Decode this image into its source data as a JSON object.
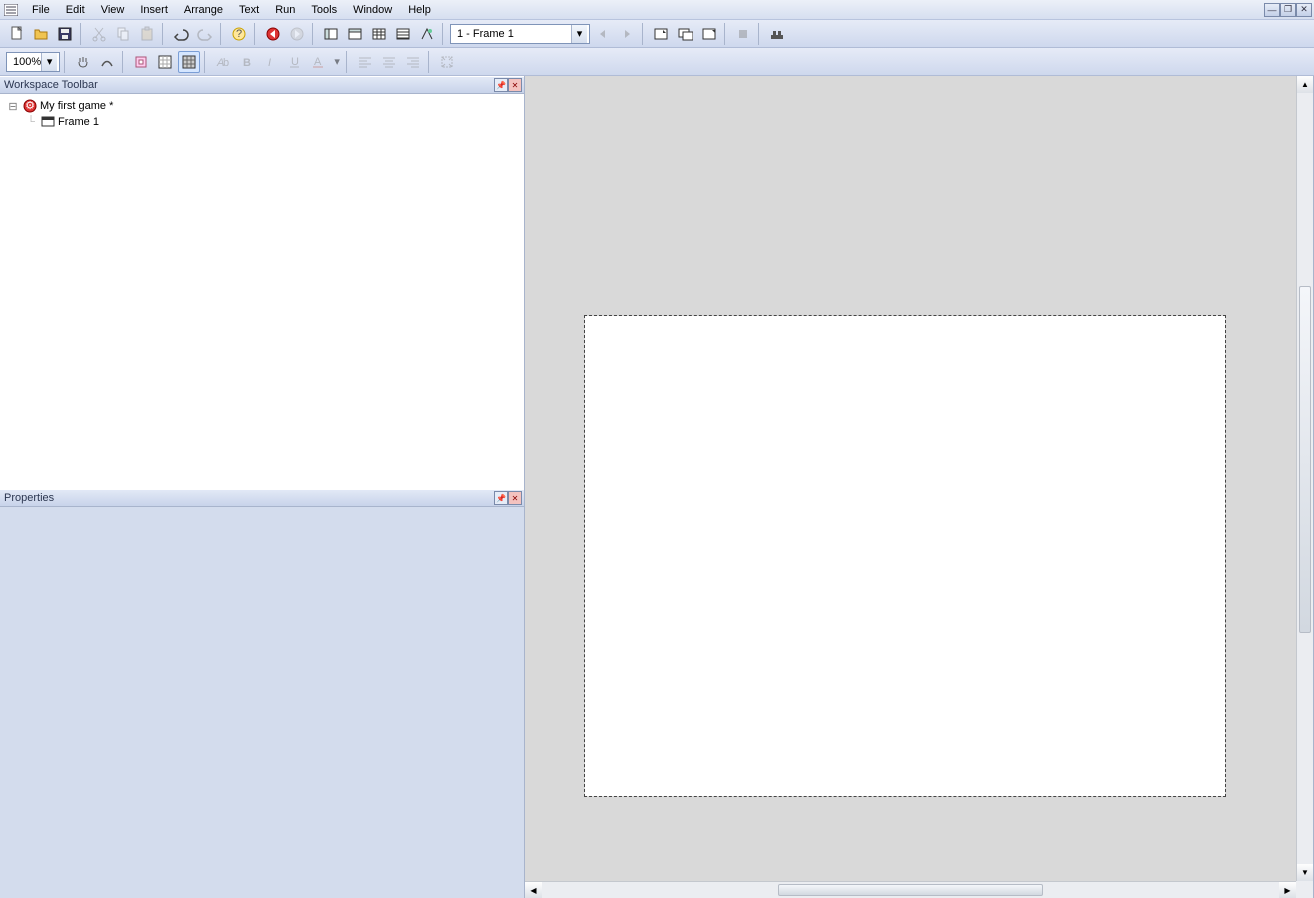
{
  "menu": {
    "items": [
      "File",
      "Edit",
      "View",
      "Insert",
      "Arrange",
      "Text",
      "Run",
      "Tools",
      "Window",
      "Help"
    ]
  },
  "toolbar1": {
    "frame_selector_value": "1 - Frame 1"
  },
  "toolbar2": {
    "zoom_value": "100%"
  },
  "workspace": {
    "title": "Workspace Toolbar",
    "project_name": "My first game *",
    "frame_name": "Frame 1"
  },
  "properties": {
    "title": "Properties"
  }
}
